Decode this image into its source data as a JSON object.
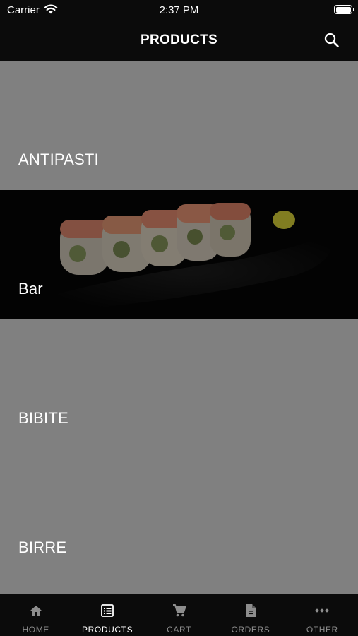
{
  "status": {
    "carrier": "Carrier",
    "time": "2:37 PM"
  },
  "nav": {
    "title": "PRODUCTS",
    "search_icon": "search-icon"
  },
  "categories": [
    {
      "label": "ANTIPASTI",
      "has_image": false
    },
    {
      "label": "Bar",
      "has_image": true,
      "image": "sushi-roll-photo"
    },
    {
      "label": "BIBITE",
      "has_image": false
    },
    {
      "label": "BIRRE",
      "has_image": false
    }
  ],
  "tabs": [
    {
      "label": "HOME",
      "icon": "home-icon",
      "active": false
    },
    {
      "label": "PRODUCTS",
      "icon": "list-icon",
      "active": true
    },
    {
      "label": "CART",
      "icon": "cart-icon",
      "active": false
    },
    {
      "label": "ORDERS",
      "icon": "document-icon",
      "active": false
    },
    {
      "label": "OTHER",
      "icon": "more-icon",
      "active": false
    }
  ],
  "colors": {
    "bar_bg": "#0b0b0b",
    "tile_bg": "#808080",
    "active_tab": "#ffffff",
    "inactive_tab": "#8d8d8d"
  }
}
